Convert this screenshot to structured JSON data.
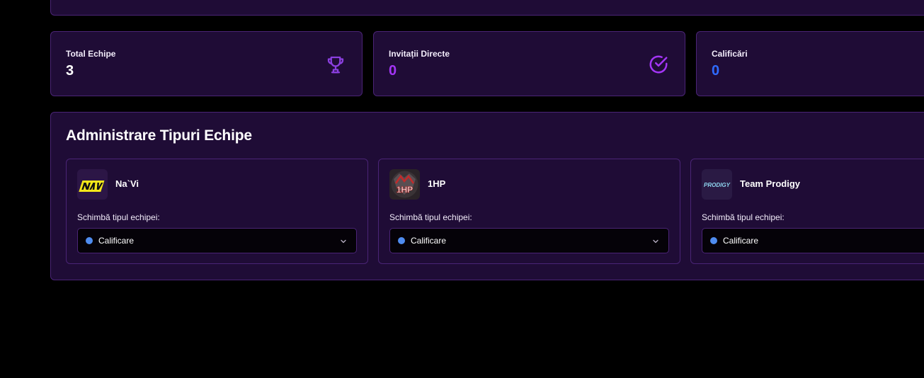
{
  "stats": [
    {
      "label": "Total Echipe",
      "value": "3",
      "value_color": "#ffffff",
      "icon": "trophy-icon",
      "icon_color": "#8b3fe0"
    },
    {
      "label": "Invitații Directe",
      "value": "0",
      "value_color": "#a335f5",
      "icon": "check-circle-icon",
      "icon_color": "#a335f5"
    },
    {
      "label": "Calificări",
      "value": "0",
      "value_color": "#2f6bff"
    }
  ],
  "admin": {
    "title": "Administrare Tipuri Echipe",
    "teams": [
      {
        "name": "Na`Vi",
        "logo": "navi-logo",
        "field_label": "Schimbă tipul echipei:",
        "selected": "Calificare",
        "dot_color": "#4f8cf0"
      },
      {
        "name": "1HP",
        "logo": "1hp-logo",
        "field_label": "Schimbă tipul echipei:",
        "selected": "Calificare",
        "dot_color": "#4f8cf0"
      },
      {
        "name": "Team Prodigy",
        "logo": "prodigy-logo",
        "logo_text": "PRODIGY",
        "field_label": "Schimbă tipul echipei:",
        "selected": "Calificare",
        "dot_color": "#4f8cf0"
      }
    ]
  },
  "colors": {
    "background": "#000000",
    "card": "#1f0c36",
    "border": "#4a2476",
    "accent_purple": "#a335f5",
    "accent_blue": "#2f6bff"
  }
}
